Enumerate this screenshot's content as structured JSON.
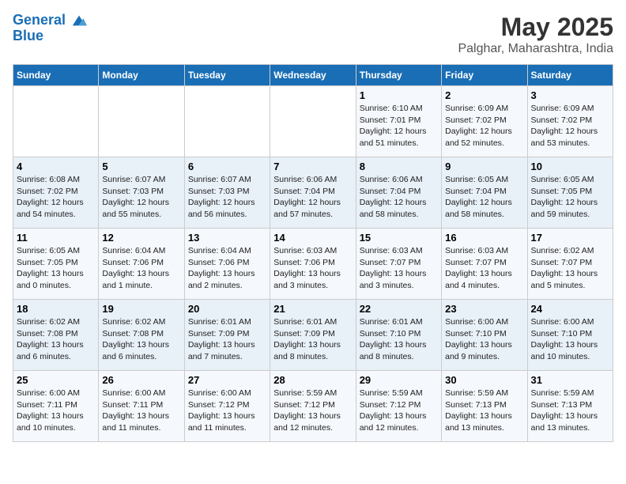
{
  "logo": {
    "line1": "General",
    "line2": "Blue"
  },
  "title": "May 2025",
  "subtitle": "Palghar, Maharashtra, India",
  "days_header": [
    "Sunday",
    "Monday",
    "Tuesday",
    "Wednesday",
    "Thursday",
    "Friday",
    "Saturday"
  ],
  "weeks": [
    [
      {
        "num": "",
        "info": ""
      },
      {
        "num": "",
        "info": ""
      },
      {
        "num": "",
        "info": ""
      },
      {
        "num": "",
        "info": ""
      },
      {
        "num": "1",
        "info": "Sunrise: 6:10 AM\nSunset: 7:01 PM\nDaylight: 12 hours\nand 51 minutes."
      },
      {
        "num": "2",
        "info": "Sunrise: 6:09 AM\nSunset: 7:02 PM\nDaylight: 12 hours\nand 52 minutes."
      },
      {
        "num": "3",
        "info": "Sunrise: 6:09 AM\nSunset: 7:02 PM\nDaylight: 12 hours\nand 53 minutes."
      }
    ],
    [
      {
        "num": "4",
        "info": "Sunrise: 6:08 AM\nSunset: 7:02 PM\nDaylight: 12 hours\nand 54 minutes."
      },
      {
        "num": "5",
        "info": "Sunrise: 6:07 AM\nSunset: 7:03 PM\nDaylight: 12 hours\nand 55 minutes."
      },
      {
        "num": "6",
        "info": "Sunrise: 6:07 AM\nSunset: 7:03 PM\nDaylight: 12 hours\nand 56 minutes."
      },
      {
        "num": "7",
        "info": "Sunrise: 6:06 AM\nSunset: 7:04 PM\nDaylight: 12 hours\nand 57 minutes."
      },
      {
        "num": "8",
        "info": "Sunrise: 6:06 AM\nSunset: 7:04 PM\nDaylight: 12 hours\nand 58 minutes."
      },
      {
        "num": "9",
        "info": "Sunrise: 6:05 AM\nSunset: 7:04 PM\nDaylight: 12 hours\nand 58 minutes."
      },
      {
        "num": "10",
        "info": "Sunrise: 6:05 AM\nSunset: 7:05 PM\nDaylight: 12 hours\nand 59 minutes."
      }
    ],
    [
      {
        "num": "11",
        "info": "Sunrise: 6:05 AM\nSunset: 7:05 PM\nDaylight: 13 hours\nand 0 minutes."
      },
      {
        "num": "12",
        "info": "Sunrise: 6:04 AM\nSunset: 7:06 PM\nDaylight: 13 hours\nand 1 minute."
      },
      {
        "num": "13",
        "info": "Sunrise: 6:04 AM\nSunset: 7:06 PM\nDaylight: 13 hours\nand 2 minutes."
      },
      {
        "num": "14",
        "info": "Sunrise: 6:03 AM\nSunset: 7:06 PM\nDaylight: 13 hours\nand 3 minutes."
      },
      {
        "num": "15",
        "info": "Sunrise: 6:03 AM\nSunset: 7:07 PM\nDaylight: 13 hours\nand 3 minutes."
      },
      {
        "num": "16",
        "info": "Sunrise: 6:03 AM\nSunset: 7:07 PM\nDaylight: 13 hours\nand 4 minutes."
      },
      {
        "num": "17",
        "info": "Sunrise: 6:02 AM\nSunset: 7:07 PM\nDaylight: 13 hours\nand 5 minutes."
      }
    ],
    [
      {
        "num": "18",
        "info": "Sunrise: 6:02 AM\nSunset: 7:08 PM\nDaylight: 13 hours\nand 6 minutes."
      },
      {
        "num": "19",
        "info": "Sunrise: 6:02 AM\nSunset: 7:08 PM\nDaylight: 13 hours\nand 6 minutes."
      },
      {
        "num": "20",
        "info": "Sunrise: 6:01 AM\nSunset: 7:09 PM\nDaylight: 13 hours\nand 7 minutes."
      },
      {
        "num": "21",
        "info": "Sunrise: 6:01 AM\nSunset: 7:09 PM\nDaylight: 13 hours\nand 8 minutes."
      },
      {
        "num": "22",
        "info": "Sunrise: 6:01 AM\nSunset: 7:10 PM\nDaylight: 13 hours\nand 8 minutes."
      },
      {
        "num": "23",
        "info": "Sunrise: 6:00 AM\nSunset: 7:10 PM\nDaylight: 13 hours\nand 9 minutes."
      },
      {
        "num": "24",
        "info": "Sunrise: 6:00 AM\nSunset: 7:10 PM\nDaylight: 13 hours\nand 10 minutes."
      }
    ],
    [
      {
        "num": "25",
        "info": "Sunrise: 6:00 AM\nSunset: 7:11 PM\nDaylight: 13 hours\nand 10 minutes."
      },
      {
        "num": "26",
        "info": "Sunrise: 6:00 AM\nSunset: 7:11 PM\nDaylight: 13 hours\nand 11 minutes."
      },
      {
        "num": "27",
        "info": "Sunrise: 6:00 AM\nSunset: 7:12 PM\nDaylight: 13 hours\nand 11 minutes."
      },
      {
        "num": "28",
        "info": "Sunrise: 5:59 AM\nSunset: 7:12 PM\nDaylight: 13 hours\nand 12 minutes."
      },
      {
        "num": "29",
        "info": "Sunrise: 5:59 AM\nSunset: 7:12 PM\nDaylight: 13 hours\nand 12 minutes."
      },
      {
        "num": "30",
        "info": "Sunrise: 5:59 AM\nSunset: 7:13 PM\nDaylight: 13 hours\nand 13 minutes."
      },
      {
        "num": "31",
        "info": "Sunrise: 5:59 AM\nSunset: 7:13 PM\nDaylight: 13 hours\nand 13 minutes."
      }
    ]
  ]
}
